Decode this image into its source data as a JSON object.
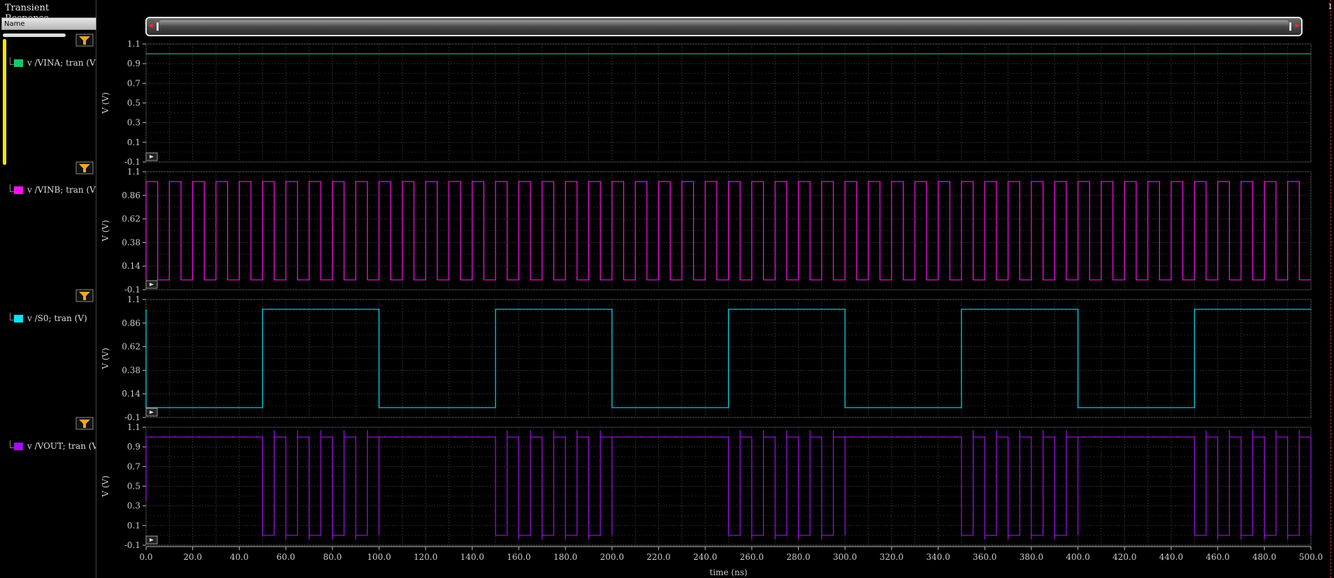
{
  "panel_title": "Transient Response",
  "name_column_header": "Name",
  "right_edge_label": "1",
  "signals": [
    {
      "label": "v /VINA; tran (V)",
      "color": "#19c76a"
    },
    {
      "label": "v /VINB; tran (V)",
      "color": "#ff10f0"
    },
    {
      "label": "v /S0; tran (V)",
      "color": "#00e5f0"
    },
    {
      "label": "v /VOUT; tran (V)",
      "color": "#a010f0"
    }
  ],
  "icons": {
    "filter": "filter-funnel-icon",
    "expand": "play-triangle-icon",
    "scroll_left": "arrow-left-icon",
    "scroll_right": "arrow-right-icon"
  },
  "colors": {
    "background": "#000000",
    "grid": "#3a3a3a",
    "axis": "#bbbbbb",
    "filter_icon": "#f5a623"
  },
  "chart_data": [
    {
      "type": "line",
      "series": [
        {
          "name": "v /VINA; tran (V)",
          "x": [
            0,
            500
          ],
          "y": [
            1.0,
            1.0
          ]
        }
      ],
      "ylabel": "V (V)",
      "yticks": [
        "1.1",
        "0.9",
        "0.7",
        "0.5",
        "0.3",
        "0.1",
        "-0.1"
      ],
      "ylim": [
        -0.1,
        1.1
      ],
      "xlim": [
        0,
        500
      ],
      "grid": true
    },
    {
      "type": "line",
      "series": [
        {
          "name": "v /VINB; tran (V)",
          "waveform": "square",
          "period": 10,
          "low": 0.0,
          "high": 1.0,
          "start_level": "high",
          "x_range": [
            0,
            500
          ]
        }
      ],
      "ylabel": "V (V)",
      "yticks": [
        "1.1",
        "0.86",
        "0.62",
        "0.38",
        "0.14",
        "-0.1"
      ],
      "ylim": [
        -0.1,
        1.1
      ],
      "xlim": [
        0,
        500
      ],
      "grid": true
    },
    {
      "type": "line",
      "series": [
        {
          "name": "v /S0; tran (V)",
          "waveform": "square",
          "period": 100,
          "low": 0.0,
          "high": 1.0,
          "start_level": "low",
          "x_range": [
            0,
            500
          ]
        }
      ],
      "ylabel": "V (V)",
      "yticks": [
        "1.1",
        "0.86",
        "0.62",
        "0.38",
        "0.14",
        "-0.1"
      ],
      "ylim": [
        -0.1,
        1.1
      ],
      "xlim": [
        0,
        500
      ],
      "grid": true
    },
    {
      "type": "line",
      "series": [
        {
          "name": "v /VOUT; tran (V)",
          "waveform": "mux_output",
          "high": 1.0,
          "low": 0.0,
          "description_of_behavior_ranges": [
            [
              0,
              50,
              "VINA"
            ],
            [
              50,
              100,
              "VINB"
            ],
            [
              100,
              150,
              "VINA"
            ],
            [
              150,
              200,
              "VINB"
            ],
            [
              200,
              250,
              "VINA"
            ],
            [
              250,
              300,
              "VINB"
            ],
            [
              300,
              350,
              "VINA"
            ],
            [
              350,
              400,
              "VINB"
            ],
            [
              400,
              450,
              "VINA"
            ],
            [
              450,
              500,
              "VINB"
            ]
          ]
        }
      ],
      "ylabel": "V (V)",
      "yticks": [
        "1.1",
        "0.9",
        "0.7",
        "0.5",
        "0.3",
        "0.1",
        "-0.1"
      ],
      "ylim": [
        -0.1,
        1.1
      ],
      "xlim": [
        0,
        500
      ],
      "grid": true
    }
  ],
  "x_axis": {
    "label": "time (ns)",
    "ticks": [
      "0.0",
      "20.0",
      "40.0",
      "60.0",
      "80.0",
      "100.0",
      "120.0",
      "140.0",
      "160.0",
      "180.0",
      "200.0",
      "220.0",
      "240.0",
      "260.0",
      "280.0",
      "300.0",
      "320.0",
      "340.0",
      "360.0",
      "380.0",
      "400.0",
      "420.0",
      "440.0",
      "460.0",
      "480.0",
      "500.0"
    ]
  }
}
